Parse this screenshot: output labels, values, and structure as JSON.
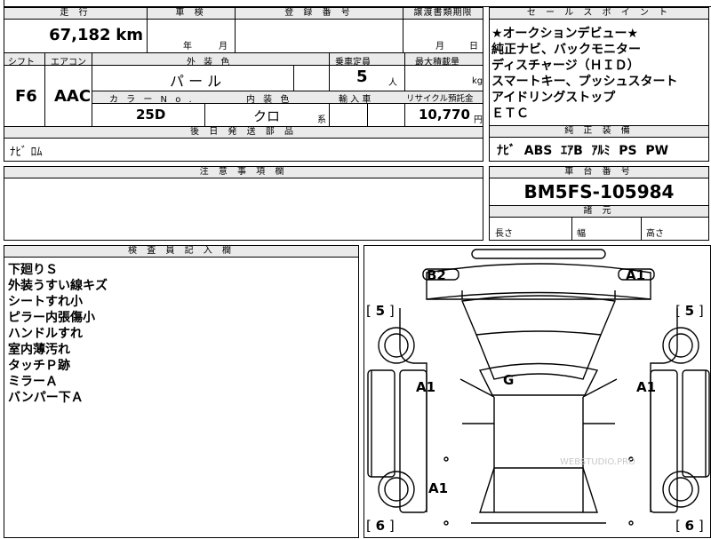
{
  "header": {
    "mileage_label": "走 行",
    "shaken_label": "車 検",
    "reg_label": "登 録 番 号",
    "transfer_label": "譲渡書類期限",
    "sales_label": "セ ー ル ス ポ イ ン ト"
  },
  "mileage": {
    "value": "67,182",
    "unit": "km"
  },
  "shaken": {
    "year_unit": "年",
    "month_unit": "月"
  },
  "transfer": {
    "month_unit": "月",
    "day_unit": "日"
  },
  "row2": {
    "shift_label": "シフト",
    "ac_label": "エアコン",
    "ext_color_label": "外 装 色",
    "capacity_label": "乗車定員",
    "max_load_label": "最大積載量",
    "shift_value": "F6",
    "ac_value": "AAC",
    "ext_color_value": "パ ー ル",
    "capacity_value": "5",
    "capacity_unit": "人",
    "load_unit": "kg",
    "color_no_label": "カ ラ ー N o .",
    "interior_label": "内 装 色",
    "import_label": "輸 入 車",
    "recycle_label": "リサイクル預託金",
    "color_no_value": "25D",
    "interior_value": "クロ",
    "interior_suffix": "系",
    "recycle_value": "10,770",
    "recycle_unit": "円"
  },
  "sales_points": [
    "★オークションデビュー★",
    "純正ナビ、バックモニター",
    "ディスチャージ（ＨＩＤ）",
    "スマートキー、プッシュスタート",
    "アイドリングストップ",
    "ＥＴＣ"
  ],
  "later_parts": {
    "label": "後 日 発 送 部 品",
    "value": "ﾅﾋﾞ ﾛﾑ"
  },
  "factory_equip": {
    "label": "純 正 装 備",
    "value": "ﾅﾋﾞ  ABS  ｴｱB  ｱﾙﾐ  PS  PW"
  },
  "notes": {
    "label": "注 意 事 項 欄"
  },
  "chassis": {
    "label": "車 台 番 号",
    "value": "BM5FS-105984"
  },
  "dims": {
    "label": "諸 元",
    "length": "長さ",
    "width": "幅",
    "height": "高さ"
  },
  "inspector": {
    "label": "検 査 員 記 入 欄",
    "lines": [
      "下廻りＳ",
      "外装うすい線キズ",
      "シートすれ小",
      "ピラー内張傷小",
      "ハンドルすれ",
      "室内薄汚れ",
      "タッチＰ跡",
      "ミラーＡ",
      "バンパー下Ａ"
    ]
  },
  "diagram": {
    "marks": [
      "B2",
      "A1",
      "A1",
      "G",
      "A1",
      "A1"
    ],
    "tire_front_left": "5",
    "tire_front_right": "5",
    "tire_rear_left": "6",
    "tire_rear_right": "6",
    "watermark": "WEBSTUDIO.PRO"
  }
}
